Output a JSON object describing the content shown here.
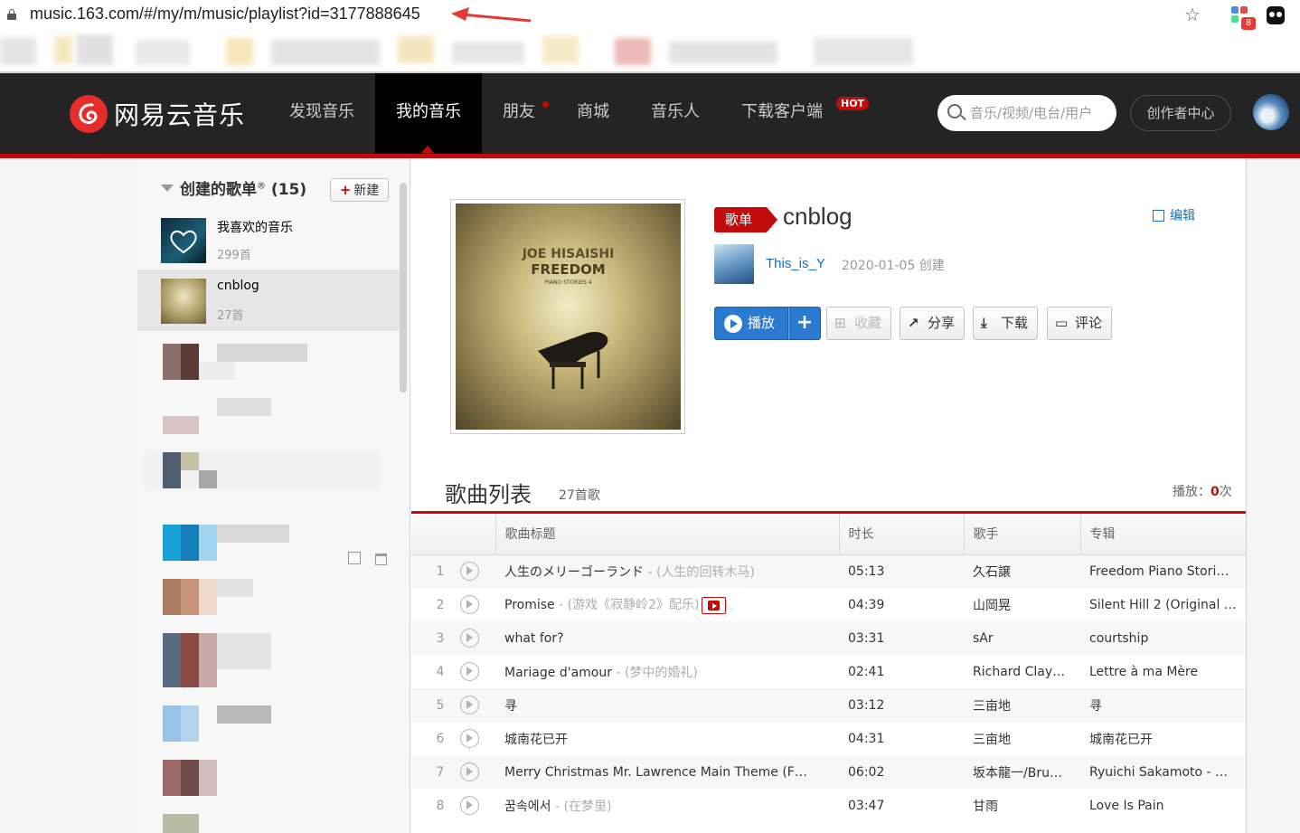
{
  "browser": {
    "url": "music.163.com/#/my/m/music/playlist?id=3177888645",
    "extension_badge": "8",
    "icons": [
      "lock-icon",
      "star-icon",
      "extension-icon",
      "profile-icon"
    ]
  },
  "header": {
    "logo_text": "网易云音乐",
    "nav": [
      {
        "label": "发现音乐"
      },
      {
        "label": "我的音乐"
      },
      {
        "label": "朋友"
      },
      {
        "label": "商城"
      },
      {
        "label": "音乐人"
      },
      {
        "label": "下载客户端"
      }
    ],
    "active_nav": "我的音乐",
    "hot_badge": "HOT",
    "search_placeholder": "音乐/视频/电台/用户",
    "creator_center": "创作者中心"
  },
  "sidebar": {
    "created_title": "创建的歌单",
    "registered_mark": "®",
    "created_count": "(15)",
    "new_label": "新建",
    "playlists": [
      {
        "name": "我喜欢的音乐",
        "count": "299首"
      },
      {
        "name": "cnblog",
        "count": "27首"
      }
    ]
  },
  "playlist": {
    "tag": "歌单",
    "title": "cnblog",
    "edit_label": "编辑",
    "creator": "This_is_Y",
    "created": "2020-01-05 创建",
    "cover_text": [
      "JOE HISAISHI",
      "FREEDOM",
      "PIANO STORIES 4"
    ],
    "actions": {
      "play": "播放",
      "add": "+",
      "collect": "收藏",
      "share": "分享",
      "download": "下载",
      "comment": "评论"
    }
  },
  "song_list": {
    "title": "歌曲列表",
    "count": "27首歌",
    "play_label": "播放：",
    "play_count": "0",
    "play_unit": "次",
    "columns": [
      "",
      "歌曲标题",
      "时长",
      "歌手",
      "专辑"
    ],
    "songs": [
      {
        "no": "1",
        "title": "人生のメリーゴーランド",
        "alias": " - (人生的回转木马)",
        "duration": "05:13",
        "artist": "久石譲",
        "album": "Freedom Piano Stori…",
        "mv": false
      },
      {
        "no": "2",
        "title": "Promise",
        "alias": " - (游戏《寂静岭2》配乐)",
        "duration": "04:39",
        "artist": "山岡晃",
        "album": "Silent Hill 2 (Original …",
        "mv": true
      },
      {
        "no": "3",
        "title": "what for?",
        "alias": "",
        "duration": "03:31",
        "artist": "sAr",
        "album": "courtship",
        "mv": false
      },
      {
        "no": "4",
        "title": "Mariage d'amour",
        "alias": " - (梦中的婚礼)",
        "duration": "02:41",
        "artist": "Richard Clay…",
        "album": "Lettre à ma Mère",
        "mv": false
      },
      {
        "no": "5",
        "title": "寻",
        "alias": "",
        "duration": "03:12",
        "artist": "三亩地",
        "album": "寻",
        "mv": false
      },
      {
        "no": "6",
        "title": "城南花已开",
        "alias": "",
        "duration": "04:31",
        "artist": "三亩地",
        "album": "城南花已开",
        "mv": false
      },
      {
        "no": "7",
        "title": "Merry Christmas Mr. Lawrence Main Theme (F…",
        "alias": "",
        "duration": "06:02",
        "artist": "坂本龍一/Bru…",
        "album": "Ryuichi Sakamoto - …",
        "mv": false
      },
      {
        "no": "8",
        "title": "꿈속에서",
        "alias": " - (在梦里)",
        "duration": "03:47",
        "artist": "甘雨",
        "album": "Love Is Pain",
        "mv": false
      }
    ]
  },
  "colors": {
    "brand_red": "#c20c0c",
    "header_bg": "#242424",
    "link_blue": "#0c73c2",
    "play_blue": "#2a7ad0"
  }
}
